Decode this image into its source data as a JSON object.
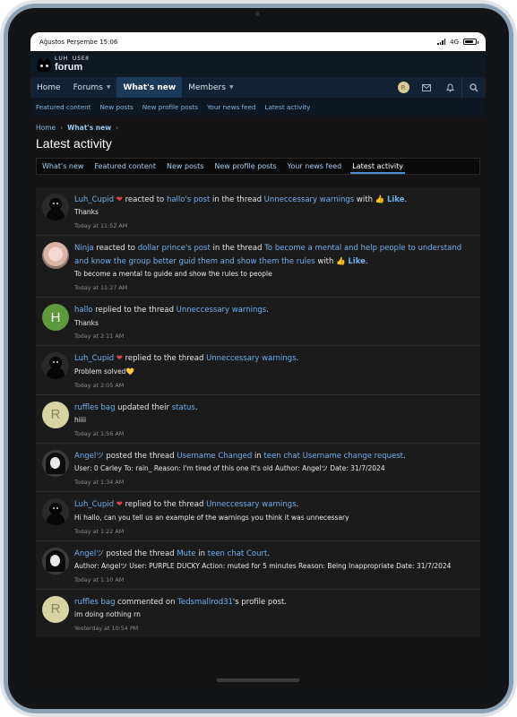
{
  "status_bar": {
    "left": "Ağustos Perşembe 15:06",
    "network": "4G"
  },
  "logo": {
    "top": "ᒪᑌᕼ ᑌSEᖇ",
    "main": "forum"
  },
  "nav": {
    "items": [
      {
        "label": "Home"
      },
      {
        "label": "Forums"
      },
      {
        "label": "What's new"
      },
      {
        "label": "Members"
      }
    ],
    "avatar_letter": "R"
  },
  "subnav": [
    "Featured content",
    "New posts",
    "New profile posts",
    "Your news feed",
    "Latest activity"
  ],
  "breadcrumb": {
    "home": "Home",
    "current": "What's new",
    "sep": "›"
  },
  "page_title": "Latest activity",
  "tabs": [
    "What's new",
    "Featured content",
    "New posts",
    "New profile posts",
    "Your news feed",
    "Latest activity"
  ],
  "activities": [
    {
      "user": "Luh_Cupid",
      "heart": "❤",
      "a1": " reacted to ",
      "l1": "hallo's post",
      "a2": " in the thread ",
      "l2": "Unneccessary warnings",
      "a3": " with ",
      "icon": "👍",
      "l3": "Like",
      "tail": ".",
      "snippet": "Thanks",
      "time": "Today at 11:52 AM"
    },
    {
      "user": "Ninja",
      "a1": " reacted to ",
      "l1": "dollar prince's post",
      "a2": " in the thread ",
      "l2": "To become a mental and help people to understand and know the group better guid them and show them the rules",
      "a3": " with ",
      "icon": "👍",
      "l3": "Like",
      "tail": ".",
      "snippet": "To become a mental to guide and show the rules to people",
      "time": "Today at 11:27 AM"
    },
    {
      "user": "hallo",
      "avatar_letter": "H",
      "a1": " replied to the thread ",
      "l1": "Unneccessary warnings",
      "tail": ".",
      "snippet": "Thanks",
      "time": "Today at 2:11 AM"
    },
    {
      "user": "Luh_Cupid",
      "heart": "❤",
      "a1": " replied to the thread ",
      "l1": "Unneccessary warnings",
      "tail": ".",
      "snippet": "Problem solved💛",
      "time": "Today at 2:05 AM"
    },
    {
      "user": "ruffles bag",
      "avatar_letter": "R",
      "a1": " updated their ",
      "l1": "status",
      "tail": ".",
      "snippet": "hiiii",
      "time": "Today at 1:56 AM"
    },
    {
      "user": "Angelツ",
      "a1": " posted the thread ",
      "l1": "Username Changed",
      "a2": " in ",
      "l2": "teen chat Username change request",
      "tail": ".",
      "snippet": "User: 0 Carley To: rain_ Reason: I'm tired of this one it's old Author: Angelツ Date: 31/7/2024",
      "time": "Today at 1:34 AM"
    },
    {
      "user": "Luh_Cupid",
      "heart": "❤",
      "a1": " replied to the thread ",
      "l1": "Unneccessary warnings",
      "tail": ".",
      "snippet": "Hi hallo, can you tell us an example of the warnings you think it was unnecessary",
      "time": "Today at 1:22 AM"
    },
    {
      "user": "Angelツ",
      "a1": " posted the thread ",
      "l1": "Mute",
      "a2": " in ",
      "l2": "teen chat Court",
      "tail": ".",
      "snippet": "Author: Angelツ User: PURPLE DUCKY Action: muted for 5 minutes Reason: Being Inappropriate Date: 31/7/2024",
      "time": "Today at 1:10 AM"
    },
    {
      "user": "ruffles bag",
      "avatar_letter": "R",
      "a1": " commented on ",
      "l1": "Tedsmallrod31",
      "tail": "'s profile post.",
      "snippet": "im doing nothing rn",
      "time": "Yesterday at 10:54 PM"
    }
  ],
  "colors": {
    "link": "#6fb0ee",
    "nav_active": "#1c3a57",
    "page_bg": "#141414"
  }
}
